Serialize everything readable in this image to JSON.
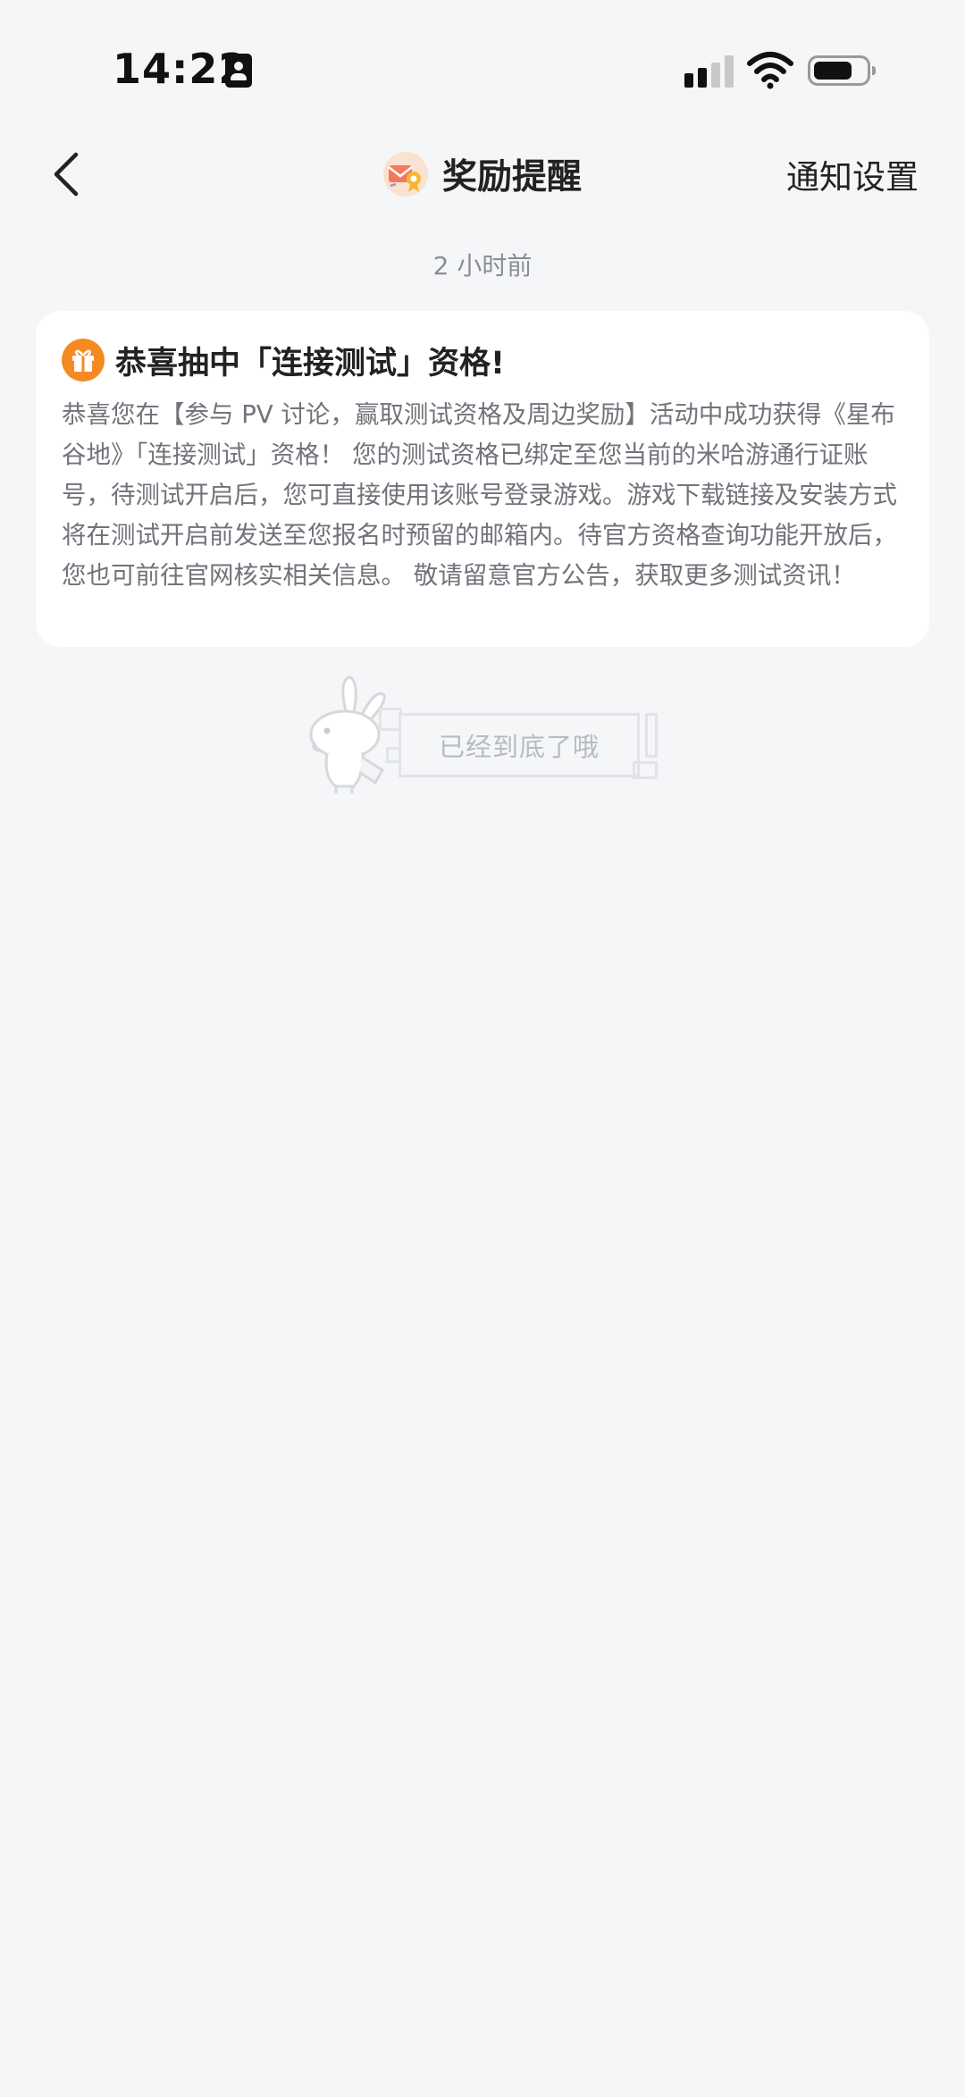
{
  "status_bar": {
    "time": "14:22",
    "icons": [
      "contact-card-icon",
      "signal-icon",
      "wifi-icon",
      "battery-icon"
    ]
  },
  "nav": {
    "back_icon": "chevron-left-icon",
    "title_icon": "reward-envelope-icon",
    "title": "奖励提醒",
    "settings_label": "通知设置"
  },
  "timestamp": "2 小时前",
  "message": {
    "icon": "gift-icon",
    "title": "恭喜抽中「连接测试」资格!",
    "body": "恭喜您在【参与 PV 讨论，赢取测试资格及周边奖励】活动中成功获得《星布谷地》「连接测试」资格！ 您的测试资格已绑定至您当前的米哈游通行证账号，待测试开启后，您可直接使用该账号登录游戏。游戏下载链接及安装方式将在测试开启前发送至您报名时预留的邮箱内。待官方资格查询功能开放后，您也可前往官网核实相关信息。 敬请留意官方公告，获取更多测试资讯！"
  },
  "footer": {
    "end_text": "已经到底了哦",
    "mascot": "rabbit-mascot-icon"
  },
  "colors": {
    "background": "#f5f6f8",
    "card": "#ffffff",
    "accent_orange": "#f58a22",
    "body_text": "#70737a",
    "muted_text": "#8a8d94"
  }
}
